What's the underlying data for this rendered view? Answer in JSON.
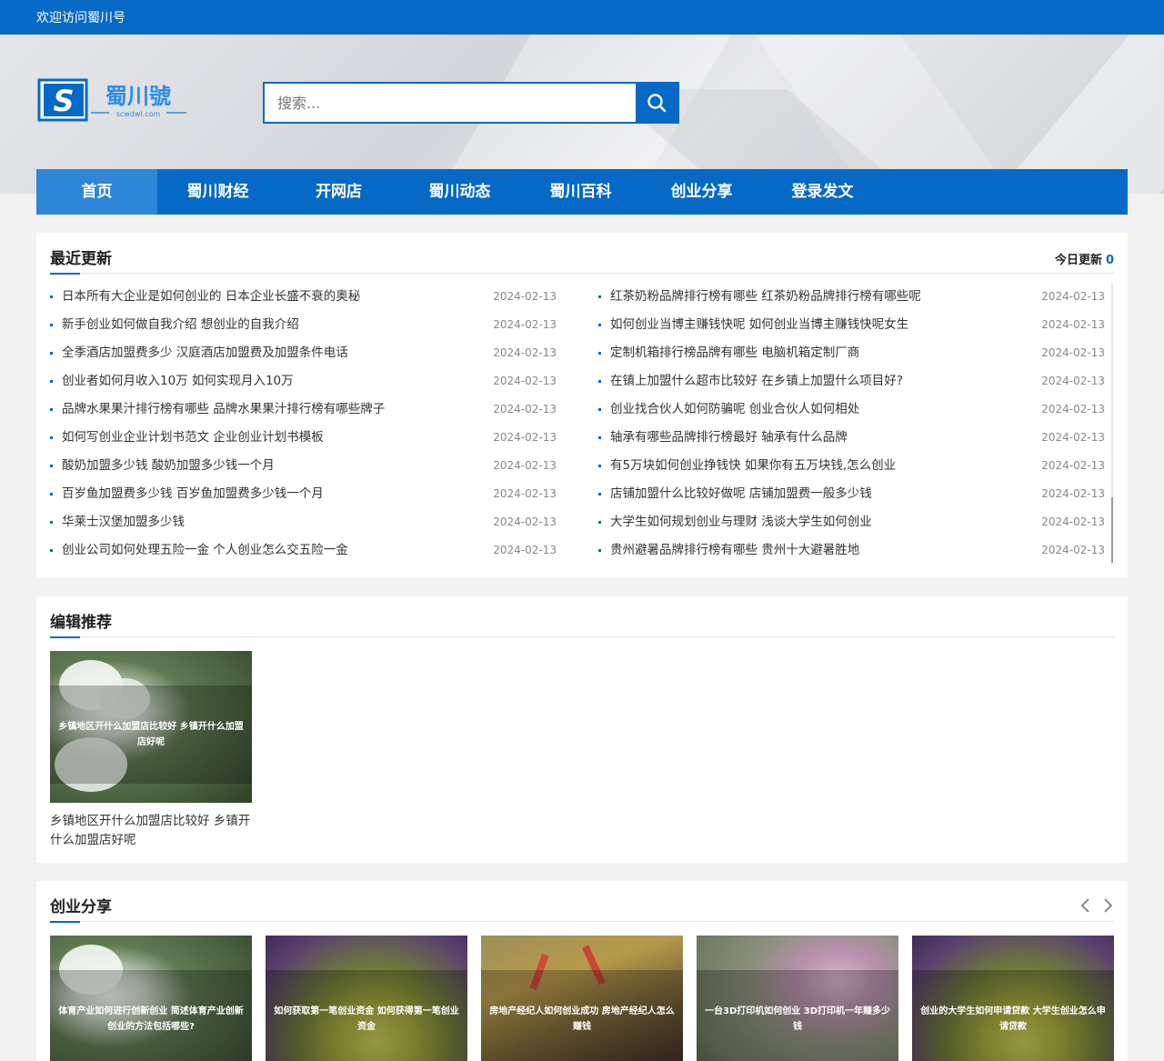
{
  "topbar": {
    "welcome": "欢迎访问蜀川号"
  },
  "logo": {
    "mark": "S",
    "name": "蜀川號",
    "domain": "scwdwl.com"
  },
  "search": {
    "placeholder": "搜索..."
  },
  "nav": {
    "items": [
      {
        "label": "首页",
        "active": true
      },
      {
        "label": "蜀川财经"
      },
      {
        "label": "开网店"
      },
      {
        "label": "蜀川动态"
      },
      {
        "label": "蜀川百科"
      },
      {
        "label": "创业分享"
      },
      {
        "label": "登录发文"
      }
    ]
  },
  "recent": {
    "title": "最近更新",
    "today_label": "今日更新",
    "today_count": "0",
    "left": [
      {
        "title": "日本所有大企业是如何创业的 日本企业长盛不衰的奥秘",
        "date": "2024-02-13"
      },
      {
        "title": "新手创业如何做自我介绍 想创业的自我介绍",
        "date": "2024-02-13"
      },
      {
        "title": "全季酒店加盟费多少 汉庭酒店加盟费及加盟条件电话",
        "date": "2024-02-13"
      },
      {
        "title": "创业者如何月收入10万 如何实现月入10万",
        "date": "2024-02-13"
      },
      {
        "title": "品牌水果果汁排行榜有哪些 品牌水果果汁排行榜有哪些牌子",
        "date": "2024-02-13"
      },
      {
        "title": "如何写创业企业计划书范文 企业创业计划书模板",
        "date": "2024-02-13"
      },
      {
        "title": "酸奶加盟多少钱 酸奶加盟多少钱一个月",
        "date": "2024-02-13"
      },
      {
        "title": "百岁鱼加盟费多少钱 百岁鱼加盟费多少钱一个月",
        "date": "2024-02-13"
      },
      {
        "title": "华莱士汉堡加盟多少钱",
        "date": "2024-02-13"
      },
      {
        "title": "创业公司如何处理五险一金 个人创业怎么交五险一金",
        "date": "2024-02-13"
      }
    ],
    "right": [
      {
        "title": "红茶奶粉品牌排行榜有哪些 红茶奶粉品牌排行榜有哪些呢",
        "date": "2024-02-13"
      },
      {
        "title": "如何创业当博主赚钱快呢 如何创业当博主赚钱快呢女生",
        "date": "2024-02-13"
      },
      {
        "title": "定制机箱排行榜品牌有哪些 电脑机箱定制厂商",
        "date": "2024-02-13"
      },
      {
        "title": "在镇上加盟什么超市比较好 在乡镇上加盟什么项目好?",
        "date": "2024-02-13"
      },
      {
        "title": "创业找合伙人如何防骗呢 创业合伙人如何相处",
        "date": "2024-02-13"
      },
      {
        "title": "轴承有哪些品牌排行榜最好 轴承有什么品牌",
        "date": "2024-02-13"
      },
      {
        "title": "有5万块如何创业挣钱快 如果你有五万块钱,怎么创业",
        "date": "2024-02-13"
      },
      {
        "title": "店铺加盟什么比较好做呢 店铺加盟费一般多少钱",
        "date": "2024-02-13"
      },
      {
        "title": "大学生如何规划创业与理财 浅谈大学生如何创业",
        "date": "2024-02-13"
      },
      {
        "title": "贵州避暑品牌排行榜有哪些 贵州十大避暑胜地",
        "date": "2024-02-13"
      }
    ]
  },
  "editor": {
    "title": "编辑推荐",
    "card": {
      "overlay": "乡镇地区开什么加盟店比较好 乡镇开什么加盟店好呢",
      "caption": "乡镇地区开什么加盟店比较好 乡镇开什么加盟店好呢"
    }
  },
  "share": {
    "title": "创业分享",
    "cards": [
      {
        "overlay": "体育产业如何进行创新创业 简述体育产业创新创业的方法包括哪些?"
      },
      {
        "overlay": "如何获取第一笔创业资金 如何获得第一笔创业资金"
      },
      {
        "overlay": "房地产经纪人如何创业成功 房地产经纪人怎么赚钱"
      },
      {
        "overlay": "一台3D打印机如何创业 3D打印机一年赚多少钱"
      },
      {
        "overlay": "创业的大学生如何申请贷款 大学生创业怎么申请贷款"
      }
    ]
  },
  "colors": {
    "brand": "#0769c6",
    "nav_active": "#2d86d6"
  }
}
